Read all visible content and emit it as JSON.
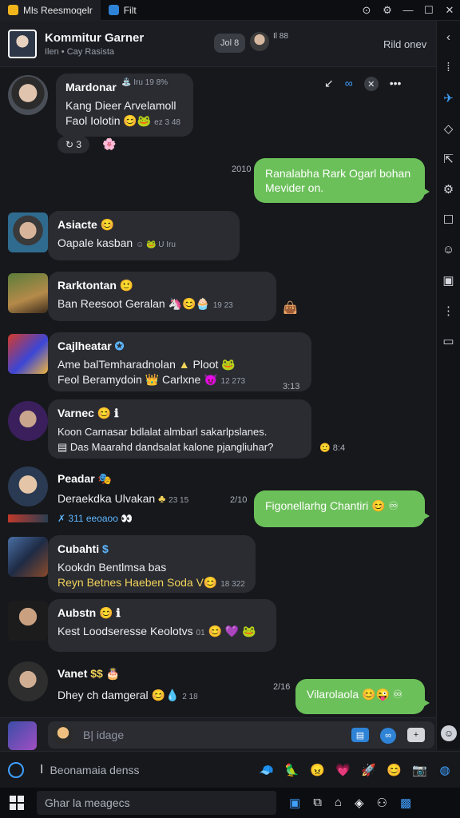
{
  "titlebar": {
    "tab1": "Mls Reesmoqelr",
    "tab2": "Filt",
    "buttons": [
      "⊙",
      "⚙",
      "—",
      "☐",
      "✕"
    ]
  },
  "header": {
    "title": "Kommitur Garner",
    "subtitle": "Ilen • Cay Rasista",
    "pill": "Jol 8",
    "mini_text": "Il 88",
    "right_label": "Rild onev"
  },
  "messages": {
    "m1": {
      "sender": "Mardonar",
      "sender_meta": "⛲ Iru 19 8%",
      "line1": "Kang Dieer Arvelamoll",
      "line2": "Faol Iolotin",
      "time": "ez 3 48",
      "reaction": "↻  3"
    },
    "m2": {
      "time": "2010",
      "text": "Ranalabha Rark Ogarl bohan Mevider on."
    },
    "m3": {
      "sender": "Asiacte",
      "text": "Oapale kasban",
      "meta": "☺ 🐸 U  Iru"
    },
    "m4": {
      "sender": "Rarktontan",
      "text": "Ban Reesoot Geralan",
      "time": "19 23"
    },
    "m5": {
      "sender": "Cajlheatar",
      "line1": "Ame balTemharadnolan",
      "line1b": "Ploot",
      "line2": "Feol Beramydoin",
      "line2b": "Carlxne",
      "time": "12 273",
      "side_time": "3:13"
    },
    "m6": {
      "sender": "Varnec",
      "line1": "Koon Carnasar bdlalat almbarl sakarlpslanes.",
      "line2": "Das Maarahd dandsalat kalone pjangliuhar?",
      "meta": "8:4"
    },
    "m7": {
      "sender": "Peadar",
      "text": "Deraekdka Ulvakan",
      "time": "23 15",
      "line2": "311 eeoaoo"
    },
    "m8": {
      "time": "2/10",
      "text": "Figonellarhg Chantiri"
    },
    "m9": {
      "sender": "Cubahti",
      "line1": "Kookdn Bentlmsa bas",
      "line2": "Reyn Betnes Haeben Soda",
      "time": "18 322"
    },
    "m10": {
      "sender": "Aubstn",
      "text": "Kest Loodseresse Keolotvs",
      "meta": "01"
    },
    "m11": {
      "sender": "Vanet",
      "text": "Dhey ch damgeral",
      "time": "2 18"
    },
    "m12": {
      "time": "2/16",
      "text": "Vilarolaola"
    }
  },
  "composer": {
    "placeholder": "B| idage"
  },
  "secondary": {
    "text": "Beonamaia denss"
  },
  "taskbar": {
    "search": "Ghar la meagecs"
  }
}
